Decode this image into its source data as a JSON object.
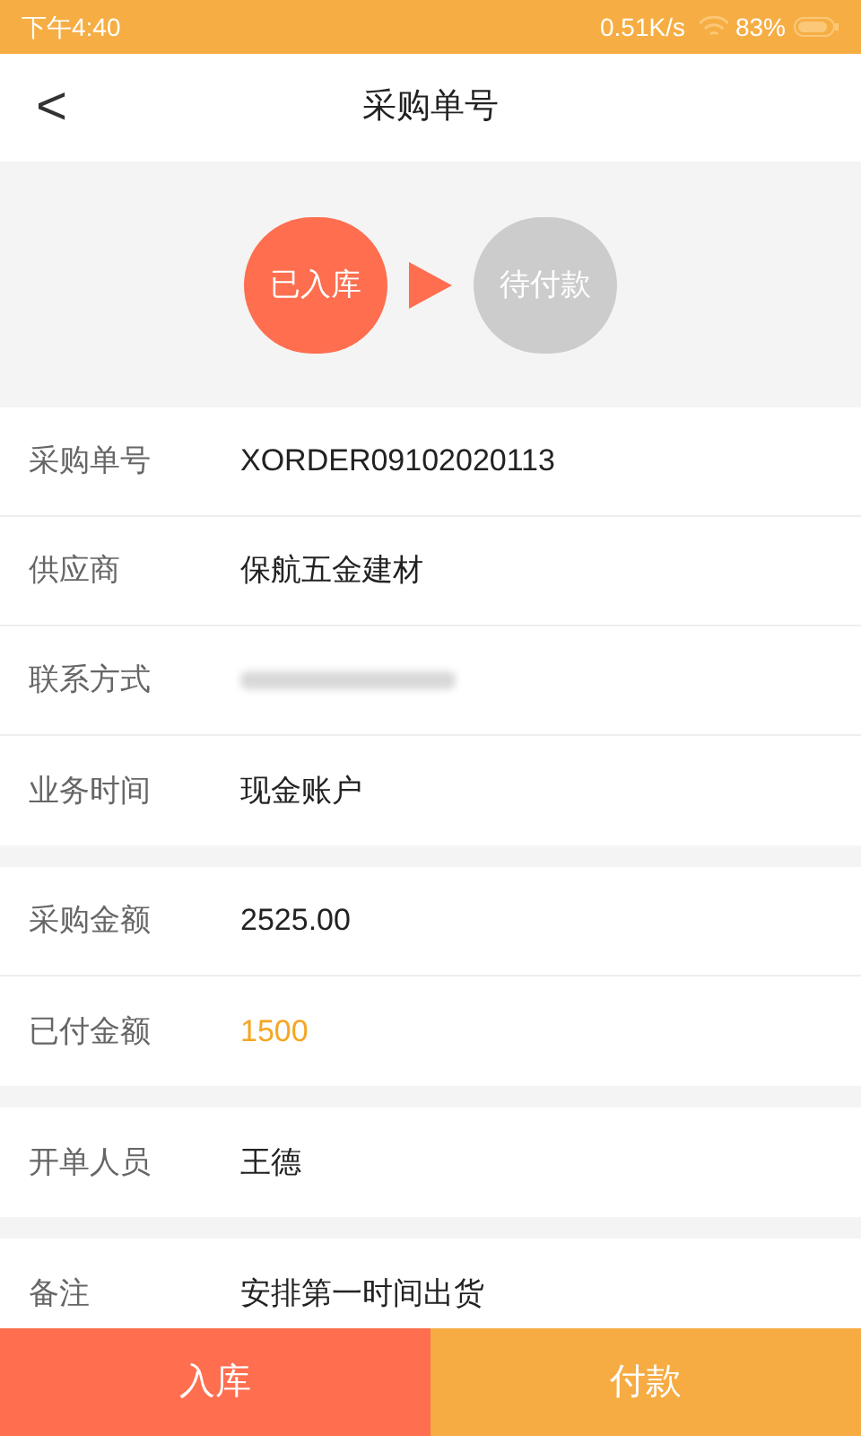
{
  "status_bar": {
    "time": "下午4:40",
    "speed": "0.51K/s",
    "battery": "83%"
  },
  "header": {
    "back": "<",
    "title": "采购单号"
  },
  "steps": [
    {
      "label": "已入库",
      "done": true
    },
    {
      "label": "待付款",
      "done": false
    }
  ],
  "sections": [
    {
      "rows": [
        {
          "label": "采购单号",
          "value": "XORDER09102020113",
          "kind": "plain"
        },
        {
          "label": "供应商",
          "value": "保航五金建材",
          "kind": "plain"
        },
        {
          "label": "联系方式",
          "kind": "redacted"
        },
        {
          "label": "业务时间",
          "value": "现金账户",
          "kind": "plain"
        }
      ]
    },
    {
      "rows": [
        {
          "label": "采购金额",
          "value": "2525.00",
          "kind": "plain"
        },
        {
          "label": "已付金额",
          "value": "1500",
          "kind": "highlight"
        }
      ]
    },
    {
      "rows": [
        {
          "label": "开单人员",
          "value": "王德",
          "kind": "plain"
        }
      ]
    },
    {
      "rows": [
        {
          "label": "备注",
          "value": "安排第一时间出货",
          "kind": "plain"
        }
      ]
    }
  ],
  "actions": [
    {
      "label": "入库",
      "kind": "primary"
    },
    {
      "label": "付款",
      "kind": "secondary"
    }
  ]
}
